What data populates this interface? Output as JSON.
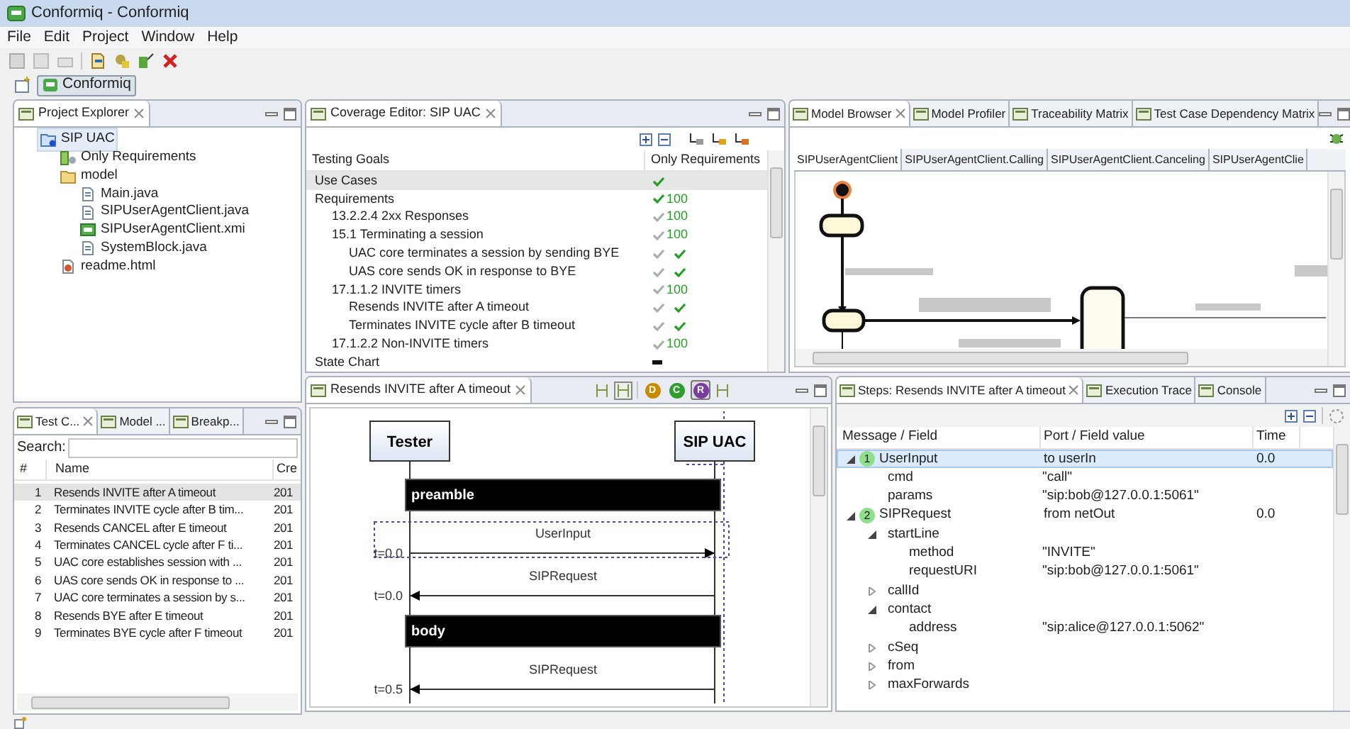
{
  "window": {
    "title": "Conformiq - Conformiq"
  },
  "menu": [
    "File",
    "Edit",
    "Project",
    "Window",
    "Help"
  ],
  "perspective": {
    "label": "Conformiq",
    "selected": true
  },
  "project_explorer": {
    "title": "Project Explorer",
    "tree": [
      {
        "label": "SIP UAC",
        "kind": "project",
        "selected": true,
        "children": [
          {
            "label": "Only Requirements",
            "kind": "config",
            "selected": false
          },
          {
            "label": "model",
            "kind": "folder",
            "selected": false,
            "children": [
              {
                "label": "Main.java",
                "kind": "java",
                "selected": false
              },
              {
                "label": "SIPUserAgentClient.java",
                "kind": "java",
                "selected": false
              },
              {
                "label": "SIPUserAgentClient.xmi",
                "kind": "xmi",
                "selected": false
              },
              {
                "label": "SystemBlock.java",
                "kind": "java",
                "selected": false
              }
            ]
          },
          {
            "label": "readme.html",
            "kind": "html",
            "selected": false
          }
        ]
      }
    ]
  },
  "coverage_editor": {
    "title": "Coverage Editor: SIP UAC",
    "columns": [
      "Testing Goals",
      "Only Requirements"
    ],
    "rows": [
      {
        "label": "Use Cases",
        "kind": "check",
        "selected": true,
        "checks": [
          {
            "covered": true
          }
        ]
      },
      {
        "label": "Requirements",
        "kind": "check",
        "selected": false,
        "checks": [
          {
            "covered": true
          }
        ],
        "count": "100",
        "children": [
          {
            "label": "13.2.2.4 2xx Responses",
            "kind": "check",
            "selected": false,
            "checks": [
              {
                "covered": false
              }
            ],
            "count": "100"
          },
          {
            "label": "15.1 Terminating a session",
            "kind": "check",
            "selected": false,
            "checks": [
              {
                "covered": false
              }
            ],
            "count": "100",
            "children": [
              {
                "label": "UAC core terminates a session by sending BYE",
                "kind": "check",
                "selected": false,
                "checks": [
                  {
                    "covered": false
                  },
                  {
                    "covered": true
                  }
                ]
              },
              {
                "label": "UAS core sends OK in response to BYE",
                "kind": "check",
                "selected": false,
                "checks": [
                  {
                    "covered": false
                  },
                  {
                    "covered": true
                  }
                ]
              }
            ]
          },
          {
            "label": "17.1.1.2 INVITE timers",
            "kind": "check",
            "selected": false,
            "checks": [
              {
                "covered": false
              }
            ],
            "count": "100",
            "children": [
              {
                "label": "Resends INVITE after A timeout",
                "kind": "check",
                "selected": false,
                "checks": [
                  {
                    "covered": false
                  },
                  {
                    "covered": true
                  }
                ]
              },
              {
                "label": "Terminates INVITE cycle after B timeout",
                "kind": "check",
                "selected": false,
                "checks": [
                  {
                    "covered": false
                  },
                  {
                    "covered": true
                  }
                ]
              }
            ]
          },
          {
            "label": "17.1.2.2 Non-INVITE timers",
            "kind": "check",
            "selected": false,
            "checks": [
              {
                "covered": false
              }
            ],
            "count": "100"
          }
        ]
      },
      {
        "label": "State Chart",
        "kind": "dash",
        "selected": false
      }
    ]
  },
  "model_browser": {
    "tabs": [
      {
        "label": "Model Browser",
        "selected": true
      },
      {
        "label": "Model Profiler",
        "selected": false
      },
      {
        "label": "Traceability Matrix",
        "selected": false
      },
      {
        "label": "Test Case Dependency Matrix",
        "selected": false
      }
    ],
    "diagram_tabs": [
      {
        "label": "SIPUserAgentClient",
        "selected": true
      },
      {
        "label": "SIPUserAgentClient.Calling",
        "selected": false
      },
      {
        "label": "SIPUserAgentClient.Canceling",
        "selected": false
      },
      {
        "label": "SIPUserAgentClie",
        "selected": false
      }
    ]
  },
  "test_cases": {
    "tabs": [
      {
        "label": "Test C...",
        "selected": true
      },
      {
        "label": "Model ...",
        "selected": false
      },
      {
        "label": "Breakp...",
        "selected": false
      }
    ],
    "search_label": "Search:",
    "columns": [
      "#",
      "Name",
      "Cre"
    ],
    "rows": [
      {
        "number": "1",
        "name": "Resends INVITE after A timeout",
        "created": "201",
        "selected": true
      },
      {
        "number": "2",
        "name": "Terminates INVITE cycle after B tim...",
        "created": "201",
        "selected": false
      },
      {
        "number": "3",
        "name": "Resends CANCEL after E timeout",
        "created": "201",
        "selected": false
      },
      {
        "number": "4",
        "name": "Terminates CANCEL cycle after F ti...",
        "created": "201",
        "selected": false
      },
      {
        "number": "5",
        "name": "UAC core establishes session with ...",
        "created": "201",
        "selected": false
      },
      {
        "number": "6",
        "name": "UAS core sends OK in response to ...",
        "created": "201",
        "selected": false
      },
      {
        "number": "7",
        "name": "UAC core terminates a session by s...",
        "created": "201",
        "selected": false
      },
      {
        "number": "8",
        "name": "Resends BYE after E timeout",
        "created": "201",
        "selected": false
      },
      {
        "number": "9",
        "name": "Terminates BYE cycle after F timeout",
        "created": "201",
        "selected": false
      }
    ]
  },
  "sequence": {
    "title": "Resends INVITE after A timeout",
    "toolbar": [
      {
        "letter": "D",
        "color": "#c98a00",
        "selected": false
      },
      {
        "letter": "C",
        "color": "#2e9e2e",
        "selected": false
      },
      {
        "letter": "R",
        "color": "#7a3c9e",
        "selected": true
      }
    ],
    "lifelines": [
      "Tester",
      "SIP UAC"
    ],
    "events": [
      {
        "kind": "block",
        "label": "preamble",
        "selected": false
      },
      {
        "kind": "send",
        "label": "UserInput",
        "time": "t=0.0",
        "selected": true
      },
      {
        "kind": "receive",
        "label": "SIPRequest",
        "time": "t=0.0",
        "selected": false
      },
      {
        "kind": "block",
        "label": "body",
        "selected": false
      },
      {
        "kind": "receive",
        "label": "SIPRequest",
        "time": "t=0.5",
        "selected": false
      }
    ]
  },
  "steps": {
    "tabs": [
      {
        "label": "Steps: Resends INVITE after A timeout",
        "selected": true
      },
      {
        "label": "Execution Trace",
        "selected": false
      },
      {
        "label": "Console",
        "selected": false
      }
    ],
    "columns": [
      "Message / Field",
      "Port / Field value",
      "Time"
    ],
    "messages": [
      {
        "step": "1",
        "name": "UserInput",
        "port": "to userIn",
        "time": "0.0",
        "selected": true,
        "expanded": true,
        "fields": [
          {
            "name": "cmd",
            "value": "\"call\""
          },
          {
            "name": "params",
            "value": "\"sip:bob@127.0.0.1:5061\""
          }
        ]
      },
      {
        "step": "2",
        "name": "SIPRequest",
        "port": "from netOut",
        "time": "0.0",
        "selected": false,
        "expanded": true,
        "fields": [
          {
            "name": "startLine",
            "expanded": true,
            "fields": [
              {
                "name": "method",
                "value": "\"INVITE\""
              },
              {
                "name": "requestURI",
                "value": "\"sip:bob@127.0.0.1:5061\""
              }
            ]
          },
          {
            "name": "callId",
            "expanded": false
          },
          {
            "name": "contact",
            "expanded": true,
            "fields": [
              {
                "name": "address",
                "value": "\"sip:alice@127.0.0.1:5062\""
              }
            ]
          },
          {
            "name": "cSeq",
            "expanded": false
          },
          {
            "name": "from",
            "expanded": false
          },
          {
            "name": "maxForwards",
            "expanded": false
          }
        ]
      }
    ]
  }
}
